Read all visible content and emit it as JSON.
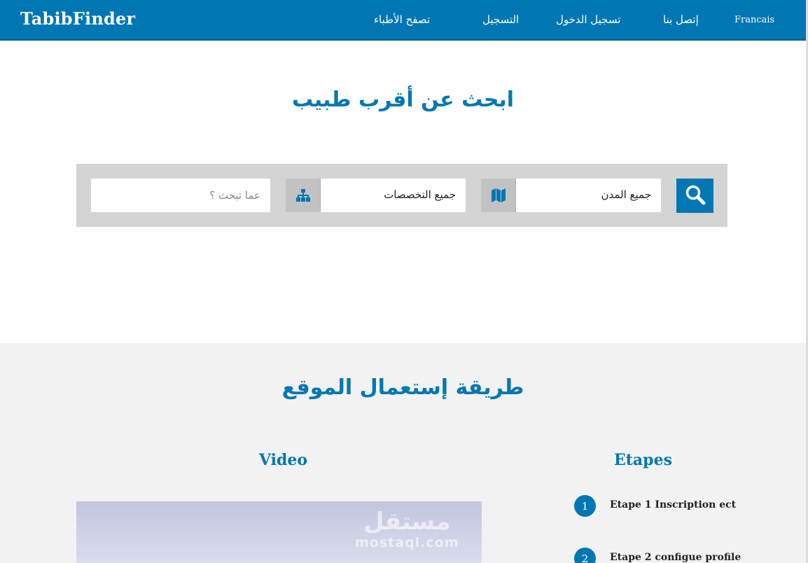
{
  "navbar": {
    "brand": "TabibFinder",
    "links": {
      "language": "Francais",
      "contact": "إتصل بنا",
      "login": "تسجيل الدخول",
      "register": "التسجيل",
      "browse": "تصفح الأطباء"
    }
  },
  "search": {
    "title": "ابحث عن أقرب طبيب",
    "query_placeholder": "عما تبحث ؟",
    "specialty_value": "جميع التخصصات",
    "city_value": "جميع المدن",
    "icons": {
      "specialty": "sitemap-icon",
      "city": "map-icon",
      "submit": "search-icon"
    }
  },
  "usage": {
    "title": "طريقة إستعمال الموقع",
    "video_heading": "Video",
    "steps_heading": "Etapes",
    "watermark": {
      "arabic": "مستقل",
      "latin": "mostaql.com"
    },
    "steps": [
      {
        "number": "1",
        "label": "Etape 1 Inscription ect"
      },
      {
        "number": "2",
        "label": "Etape 2 configue profile"
      }
    ]
  },
  "colors": {
    "primary": "#0077b3",
    "panel": "#d4d4d4",
    "section_bg": "#f2f2f2"
  }
}
